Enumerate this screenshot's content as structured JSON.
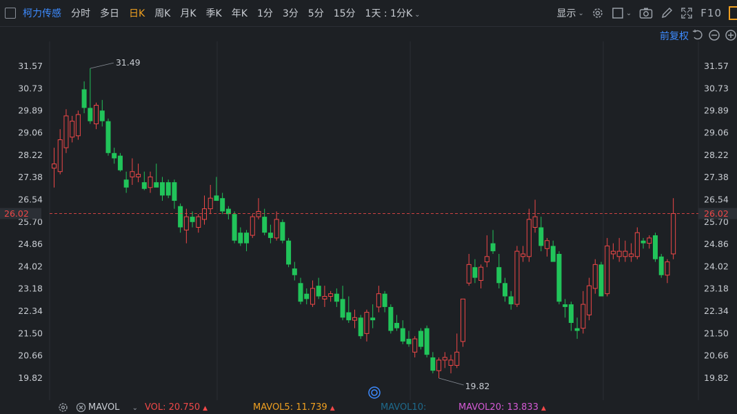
{
  "toolbar": {
    "stock_name": "柯力传感",
    "periods": [
      "分时",
      "多日",
      "日K",
      "周K",
      "月K",
      "季K",
      "年K",
      "1分",
      "3分",
      "5分",
      "15分"
    ],
    "active_period": "日K",
    "custom_period": "1天 : 1分K",
    "display_label": "显示",
    "f10_label": "F10"
  },
  "adjust_label": "前复权",
  "colors": {
    "up": "#f04848",
    "down": "#21c45a",
    "active": "#f0a020",
    "link": "#3d8bff",
    "mavol5": "#f0a020",
    "mavol10": "#1e6a8c",
    "mavol20": "#d65ad6"
  },
  "volume_bar": {
    "indicator_label": "MAVOL",
    "vol": "VOL: 20.750",
    "mavol5": "MAVOL5: 11.739",
    "mavol10": "MAVOL10:",
    "mavol20": "MAVOL20: 13.833"
  },
  "chart_data": {
    "type": "candlestick",
    "y_ticks": [
      "31.57",
      "30.73",
      "29.89",
      "29.06",
      "28.22",
      "27.38",
      "26.54",
      "25.70",
      "24.86",
      "24.02",
      "23.18",
      "22.34",
      "21.50",
      "20.66",
      "19.82"
    ],
    "ylim": [
      19.82,
      31.57
    ],
    "last_price": "26.02",
    "max_label": "31.49",
    "min_label": "19.82",
    "candles": [
      {
        "o": 27.73,
        "h": 28.5,
        "l": 27.0,
        "c": 27.89
      },
      {
        "o": 27.6,
        "h": 29.2,
        "l": 27.5,
        "c": 28.8
      },
      {
        "o": 28.5,
        "h": 29.95,
        "l": 28.3,
        "c": 29.7
      },
      {
        "o": 28.9,
        "h": 29.7,
        "l": 28.7,
        "c": 29.5
      },
      {
        "o": 28.95,
        "h": 29.9,
        "l": 28.8,
        "c": 29.75
      },
      {
        "o": 30.7,
        "h": 31.0,
        "l": 29.8,
        "c": 30.0
      },
      {
        "o": 30.0,
        "h": 31.49,
        "l": 29.4,
        "c": 29.5
      },
      {
        "o": 29.4,
        "h": 30.2,
        "l": 29.2,
        "c": 30.1
      },
      {
        "o": 29.9,
        "h": 30.3,
        "l": 29.3,
        "c": 29.5
      },
      {
        "o": 29.5,
        "h": 29.6,
        "l": 28.2,
        "c": 28.3
      },
      {
        "o": 28.3,
        "h": 28.5,
        "l": 27.9,
        "c": 28.1
      },
      {
        "o": 28.2,
        "h": 28.3,
        "l": 27.6,
        "c": 27.65
      },
      {
        "o": 27.3,
        "h": 27.6,
        "l": 26.8,
        "c": 27.0
      },
      {
        "o": 27.4,
        "h": 28.1,
        "l": 27.1,
        "c": 27.6
      },
      {
        "o": 27.4,
        "h": 27.9,
        "l": 27.2,
        "c": 27.5
      },
      {
        "o": 27.2,
        "h": 27.6,
        "l": 26.9,
        "c": 26.95
      },
      {
        "o": 27.0,
        "h": 27.6,
        "l": 26.8,
        "c": 27.4
      },
      {
        "o": 27.2,
        "h": 27.9,
        "l": 27.1,
        "c": 27.0
      },
      {
        "o": 27.2,
        "h": 27.4,
        "l": 26.5,
        "c": 26.7
      },
      {
        "o": 27.2,
        "h": 27.3,
        "l": 26.6,
        "c": 26.7
      },
      {
        "o": 27.2,
        "h": 27.3,
        "l": 26.2,
        "c": 26.5
      },
      {
        "o": 26.3,
        "h": 26.4,
        "l": 25.3,
        "c": 25.5
      },
      {
        "o": 25.4,
        "h": 26.2,
        "l": 24.9,
        "c": 25.9
      },
      {
        "o": 25.9,
        "h": 26.1,
        "l": 25.5,
        "c": 25.7
      },
      {
        "o": 25.5,
        "h": 26.0,
        "l": 25.3,
        "c": 25.9
      },
      {
        "o": 25.8,
        "h": 26.7,
        "l": 25.6,
        "c": 26.2
      },
      {
        "o": 26.2,
        "h": 27.1,
        "l": 26.0,
        "c": 26.6
      },
      {
        "o": 26.7,
        "h": 27.4,
        "l": 26.5,
        "c": 26.5
      },
      {
        "o": 26.6,
        "h": 26.8,
        "l": 26.0,
        "c": 26.1
      },
      {
        "o": 26.2,
        "h": 26.3,
        "l": 25.8,
        "c": 26.0
      },
      {
        "o": 26.0,
        "h": 26.1,
        "l": 24.9,
        "c": 25.0
      },
      {
        "o": 25.3,
        "h": 25.5,
        "l": 24.8,
        "c": 24.9
      },
      {
        "o": 25.3,
        "h": 25.4,
        "l": 24.6,
        "c": 24.9
      },
      {
        "o": 25.2,
        "h": 26.0,
        "l": 25.1,
        "c": 25.9
      },
      {
        "o": 25.9,
        "h": 26.6,
        "l": 25.8,
        "c": 26.1
      },
      {
        "o": 25.9,
        "h": 26.2,
        "l": 25.2,
        "c": 25.3
      },
      {
        "o": 25.3,
        "h": 25.6,
        "l": 24.9,
        "c": 25.1
      },
      {
        "o": 25.1,
        "h": 26.1,
        "l": 25.0,
        "c": 25.8
      },
      {
        "o": 25.7,
        "h": 25.8,
        "l": 24.9,
        "c": 25.0
      },
      {
        "o": 25.0,
        "h": 25.1,
        "l": 24.0,
        "c": 24.1
      },
      {
        "o": 23.95,
        "h": 24.2,
        "l": 23.5,
        "c": 23.7
      },
      {
        "o": 23.4,
        "h": 23.6,
        "l": 22.6,
        "c": 22.7
      },
      {
        "o": 23.0,
        "h": 23.2,
        "l": 22.6,
        "c": 22.8
      },
      {
        "o": 22.6,
        "h": 23.5,
        "l": 22.5,
        "c": 23.2
      },
      {
        "o": 23.3,
        "h": 23.6,
        "l": 22.8,
        "c": 22.9
      },
      {
        "o": 22.8,
        "h": 23.3,
        "l": 22.5,
        "c": 22.9
      },
      {
        "o": 22.9,
        "h": 23.1,
        "l": 22.7,
        "c": 23.0
      },
      {
        "o": 23.0,
        "h": 23.2,
        "l": 22.5,
        "c": 22.7
      },
      {
        "o": 22.8,
        "h": 23.3,
        "l": 22.0,
        "c": 22.1
      },
      {
        "o": 22.3,
        "h": 22.9,
        "l": 21.9,
        "c": 22.0
      },
      {
        "o": 22.0,
        "h": 22.4,
        "l": 21.7,
        "c": 22.1
      },
      {
        "o": 22.1,
        "h": 22.2,
        "l": 21.3,
        "c": 21.4
      },
      {
        "o": 21.5,
        "h": 22.4,
        "l": 21.2,
        "c": 22.3
      },
      {
        "o": 22.1,
        "h": 22.6,
        "l": 21.7,
        "c": 22.0
      },
      {
        "o": 22.5,
        "h": 23.3,
        "l": 22.3,
        "c": 23.0
      },
      {
        "o": 23.0,
        "h": 23.1,
        "l": 22.3,
        "c": 22.5
      },
      {
        "o": 22.5,
        "h": 22.6,
        "l": 21.5,
        "c": 21.6
      },
      {
        "o": 21.9,
        "h": 22.2,
        "l": 21.6,
        "c": 21.7
      },
      {
        "o": 21.7,
        "h": 22.0,
        "l": 21.1,
        "c": 21.2
      },
      {
        "o": 21.3,
        "h": 21.6,
        "l": 21.0,
        "c": 21.1
      },
      {
        "o": 20.8,
        "h": 21.4,
        "l": 20.6,
        "c": 21.3
      },
      {
        "o": 21.6,
        "h": 21.7,
        "l": 20.9,
        "c": 21.0
      },
      {
        "o": 21.7,
        "h": 21.8,
        "l": 20.6,
        "c": 20.7
      },
      {
        "o": 20.6,
        "h": 20.8,
        "l": 20.0,
        "c": 20.1
      },
      {
        "o": 20.1,
        "h": 20.6,
        "l": 19.82,
        "c": 20.5
      },
      {
        "o": 20.5,
        "h": 20.8,
        "l": 20.2,
        "c": 20.6
      },
      {
        "o": 20.3,
        "h": 20.7,
        "l": 20.0,
        "c": 20.5
      },
      {
        "o": 20.3,
        "h": 21.5,
        "l": 20.2,
        "c": 20.8
      },
      {
        "o": 21.2,
        "h": 22.8,
        "l": 21.0,
        "c": 22.8
      },
      {
        "o": 23.4,
        "h": 24.5,
        "l": 23.3,
        "c": 24.1
      },
      {
        "o": 24.0,
        "h": 24.3,
        "l": 23.4,
        "c": 23.6
      },
      {
        "o": 23.5,
        "h": 24.1,
        "l": 23.2,
        "c": 24.0
      },
      {
        "o": 24.2,
        "h": 25.2,
        "l": 24.0,
        "c": 24.4
      },
      {
        "o": 24.9,
        "h": 25.4,
        "l": 24.5,
        "c": 24.6
      },
      {
        "o": 24.0,
        "h": 24.5,
        "l": 23.2,
        "c": 23.4
      },
      {
        "o": 23.4,
        "h": 23.6,
        "l": 22.7,
        "c": 22.9
      },
      {
        "o": 22.9,
        "h": 23.1,
        "l": 22.4,
        "c": 22.6
      },
      {
        "o": 22.6,
        "h": 24.8,
        "l": 22.5,
        "c": 24.6
      },
      {
        "o": 24.4,
        "h": 24.8,
        "l": 24.2,
        "c": 24.5
      },
      {
        "o": 24.4,
        "h": 26.2,
        "l": 24.2,
        "c": 25.8
      },
      {
        "o": 25.5,
        "h": 26.54,
        "l": 25.3,
        "c": 25.9
      },
      {
        "o": 25.5,
        "h": 25.9,
        "l": 24.6,
        "c": 24.8
      },
      {
        "o": 24.7,
        "h": 25.1,
        "l": 24.4,
        "c": 25.0
      },
      {
        "o": 24.8,
        "h": 25.0,
        "l": 24.2,
        "c": 24.2
      },
      {
        "o": 24.5,
        "h": 24.6,
        "l": 22.6,
        "c": 22.7
      },
      {
        "o": 22.6,
        "h": 22.8,
        "l": 22.1,
        "c": 22.5
      },
      {
        "o": 22.6,
        "h": 22.7,
        "l": 21.6,
        "c": 21.9
      },
      {
        "o": 21.7,
        "h": 22.1,
        "l": 21.3,
        "c": 21.6
      },
      {
        "o": 21.7,
        "h": 23.1,
        "l": 21.5,
        "c": 22.6
      },
      {
        "o": 22.2,
        "h": 23.6,
        "l": 22.0,
        "c": 23.3
      },
      {
        "o": 23.2,
        "h": 24.3,
        "l": 23.0,
        "c": 24.1
      },
      {
        "o": 24.1,
        "h": 24.2,
        "l": 22.9,
        "c": 22.9
      },
      {
        "o": 23.0,
        "h": 25.1,
        "l": 22.9,
        "c": 24.8
      },
      {
        "o": 24.5,
        "h": 24.9,
        "l": 24.3,
        "c": 24.6
      },
      {
        "o": 24.4,
        "h": 25.1,
        "l": 24.2,
        "c": 24.6
      },
      {
        "o": 24.4,
        "h": 25.0,
        "l": 24.2,
        "c": 24.6
      },
      {
        "o": 24.4,
        "h": 24.9,
        "l": 24.2,
        "c": 24.5
      },
      {
        "o": 24.4,
        "h": 25.5,
        "l": 24.3,
        "c": 25.3
      },
      {
        "o": 25.0,
        "h": 25.1,
        "l": 24.7,
        "c": 24.9
      },
      {
        "o": 24.9,
        "h": 25.2,
        "l": 24.7,
        "c": 25.1
      },
      {
        "o": 25.2,
        "h": 25.3,
        "l": 24.2,
        "c": 24.3
      },
      {
        "o": 24.4,
        "h": 24.5,
        "l": 23.6,
        "c": 23.7
      },
      {
        "o": 23.7,
        "h": 24.3,
        "l": 23.4,
        "c": 24.2
      },
      {
        "o": 24.5,
        "h": 26.6,
        "l": 24.3,
        "c": 26.02
      }
    ]
  }
}
